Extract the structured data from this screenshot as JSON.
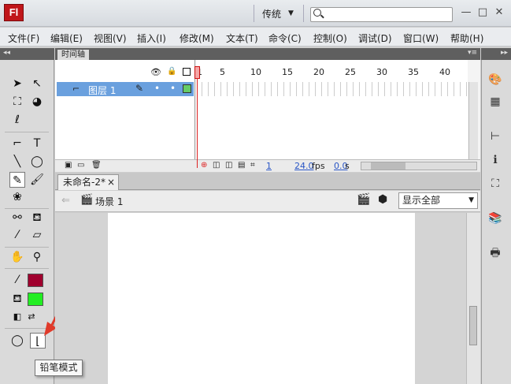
{
  "app": {
    "logo_text": "Fl"
  },
  "titlebar": {
    "workspace": "传统",
    "workspace_arrow": "▼",
    "minimize": "—",
    "restore": "□",
    "close": "✕"
  },
  "menu": [
    "文件(F)",
    "编辑(E)",
    "视图(V)",
    "插入(I)",
    "修改(M)",
    "文本(T)",
    "命令(C)",
    "控制(O)",
    "调试(D)",
    "窗口(W)",
    "帮助(H)"
  ],
  "timeline": {
    "tab_label": "时间轴",
    "layer_name": "图层 1",
    "frame_numbers": [
      "1",
      "5",
      "10",
      "15",
      "20",
      "25",
      "30",
      "35",
      "40"
    ],
    "current_frame": "1",
    "fps": "24.0",
    "fps_unit": "fps",
    "time": "0.0",
    "time_unit": "s"
  },
  "document": {
    "tab_label": "未命名-2*",
    "close": "×"
  },
  "scene": {
    "label": "场景 1",
    "zoom_value": "显示全部"
  },
  "tooltip": {
    "text": "铅笔模式"
  },
  "colors": {
    "stroke": "#a0002e",
    "fill": "#22ee22",
    "accent_red": "#e03a2a",
    "layer_highlight": "#6aa0de"
  },
  "tools": {
    "text_tool_glyph": "T"
  }
}
